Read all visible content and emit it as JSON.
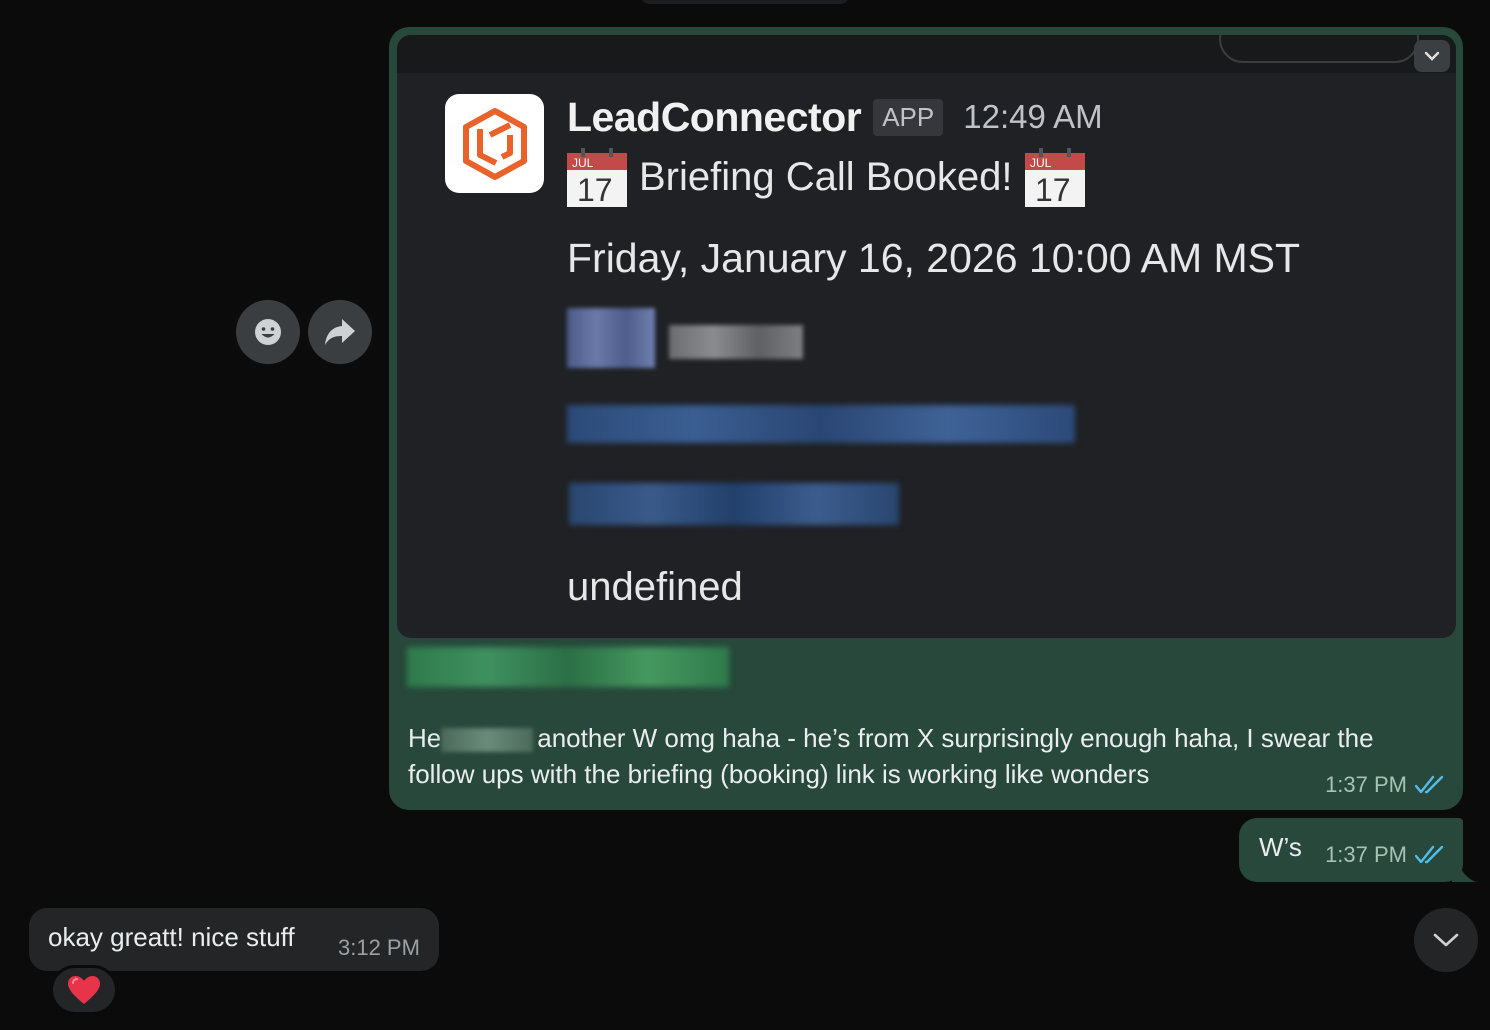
{
  "actions": {
    "react_icon": "smiley-icon",
    "forward_icon": "forward-arrow-icon"
  },
  "card": {
    "sender_name": "LeadConnector",
    "app_badge": "APP",
    "sent_time": "12:49 AM",
    "calendar_month": "JUL",
    "calendar_day": "17",
    "headline": "Briefing Call Booked!",
    "datetime": "Friday, January 16, 2026 10:00 AM MST",
    "undefined_line": "undefined"
  },
  "main_message": {
    "text_start": "He",
    "text_rest": "another W omg haha - he’s from X surprisingly enough haha, I swear the follow ups with the briefing (booking) link is working like wonders",
    "time": "1:37 PM",
    "status_icon": "double-check-icon"
  },
  "ws_message": {
    "text": "W’s",
    "time": "1:37 PM"
  },
  "incoming_message": {
    "text": "okay greatt! nice stuff",
    "time": "3:12 PM",
    "reaction": "❤️"
  },
  "colors": {
    "outgoing_bubble": "#27483a",
    "incoming_bubble": "#232527",
    "read_ticks": "#53bdeb",
    "logo_orange": "#e8622a"
  }
}
